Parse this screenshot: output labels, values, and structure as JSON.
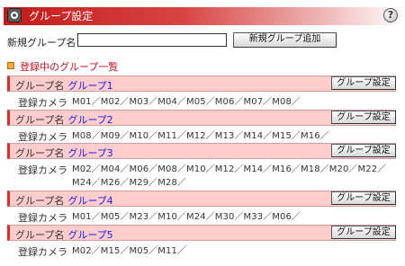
{
  "title": {
    "text": "グループ設定",
    "help_icon": "?"
  },
  "new_group": {
    "label": "新規グループ名",
    "value": "",
    "add_button": "新規グループ追加"
  },
  "section": {
    "heading": "登録中のグループ一覧"
  },
  "group_label": "グループ名",
  "camera_label": "登録カメラ",
  "settings_button": "グループ設定",
  "groups": [
    {
      "name": "グループ1",
      "cameras": "M01／M02／M03／M04／M05／M06／M07／M08／"
    },
    {
      "name": "グループ2",
      "cameras": "M08／M09／M10／M11／M12／M13／M14／M15／M16／"
    },
    {
      "name": "グループ3",
      "cameras": "M02／M04／M06／M08／M10／M12／M14／M16／M18／M20／M22／M24／M26／M29／M28／"
    },
    {
      "name": "グループ4",
      "cameras": "M01／M05／M23／M10／M24／M30／M33／M06／"
    },
    {
      "name": "グループ5",
      "cameras": "M02／M15／M05／M11／"
    }
  ],
  "colors": {
    "title_red": "#c41a1a",
    "group_bar_bg": "#ffcccc",
    "group_name_blue": "#1a1aee",
    "section_red": "#c2141d"
  }
}
